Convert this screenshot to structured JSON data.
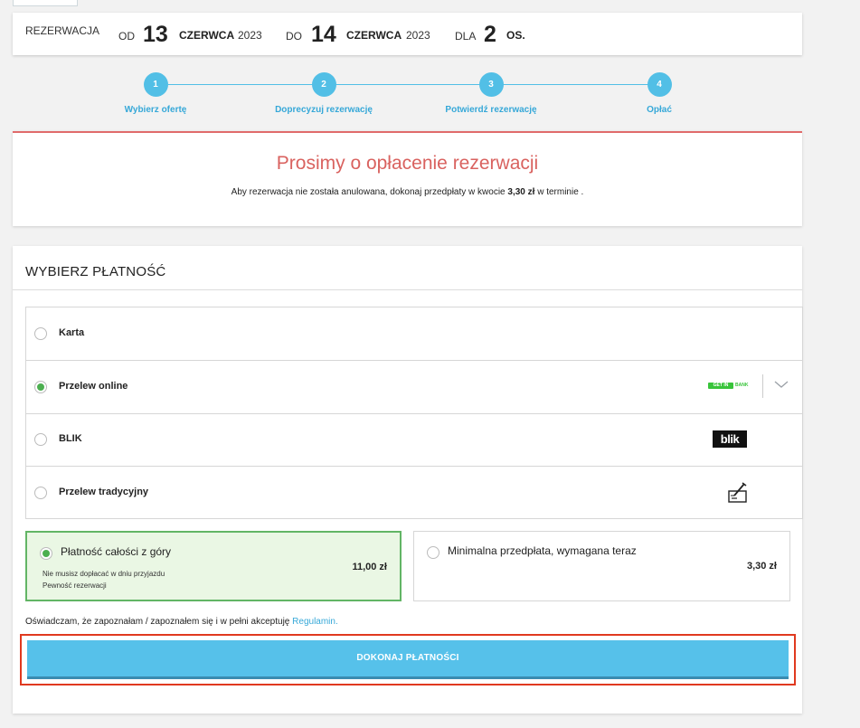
{
  "reservation": {
    "label": "REZERWACJA",
    "from_label": "OD",
    "from_day": "13",
    "from_month": "CZERWCA",
    "from_year": "2023",
    "to_label": "DO",
    "to_day": "14",
    "to_month": "CZERWCA",
    "to_year": "2023",
    "guests_label": "DLA",
    "guests_count": "2",
    "guests_unit": "OS."
  },
  "steps": [
    {
      "num": "1",
      "label": "Wybierz ofertę"
    },
    {
      "num": "2",
      "label": "Doprecyzuj rezerwację"
    },
    {
      "num": "3",
      "label": "Potwierdź rezerwację"
    },
    {
      "num": "4",
      "label": "Opłać"
    }
  ],
  "notice": {
    "title": "Prosimy o opłacenie rezerwacji",
    "text_before": "Aby rezerwacja nie została anulowana, dokonaj przedpłaty w kwocie",
    "amount": "3,30 zł",
    "text_after": "w terminie ."
  },
  "payment": {
    "heading": "WYBIERZ PŁATNOŚĆ",
    "methods": [
      {
        "label": "Karta",
        "selected": false
      },
      {
        "label": "Przelew online",
        "selected": true,
        "logo_text": "GET IN",
        "logo_sub": "BANK"
      },
      {
        "label": "BLIK",
        "selected": false,
        "logo_text": "blik"
      },
      {
        "label": "Przelew tradycyjny",
        "selected": false
      }
    ],
    "options": [
      {
        "title": "Płatność całości z góry",
        "price": "11,00 zł",
        "selected": true,
        "notes": [
          "Nie musisz dopłacać w dniu przyjazdu",
          "Pewność rezerwacji"
        ]
      },
      {
        "title": "Minimalna przedpłata, wymagana teraz",
        "price": "3,30 zł",
        "selected": false
      }
    ],
    "accept_text": "Oświadczam, że zapoznałam / zapoznałem się i w pełni akceptuję",
    "accept_link": "Regulamin.",
    "pay_button": "DOKONAJ PŁATNOŚCI"
  },
  "colors": {
    "accent": "#52bfe6",
    "title_red": "#d9625f",
    "selected_green": "#4caf50",
    "highlight_frame": "#e0391f"
  }
}
